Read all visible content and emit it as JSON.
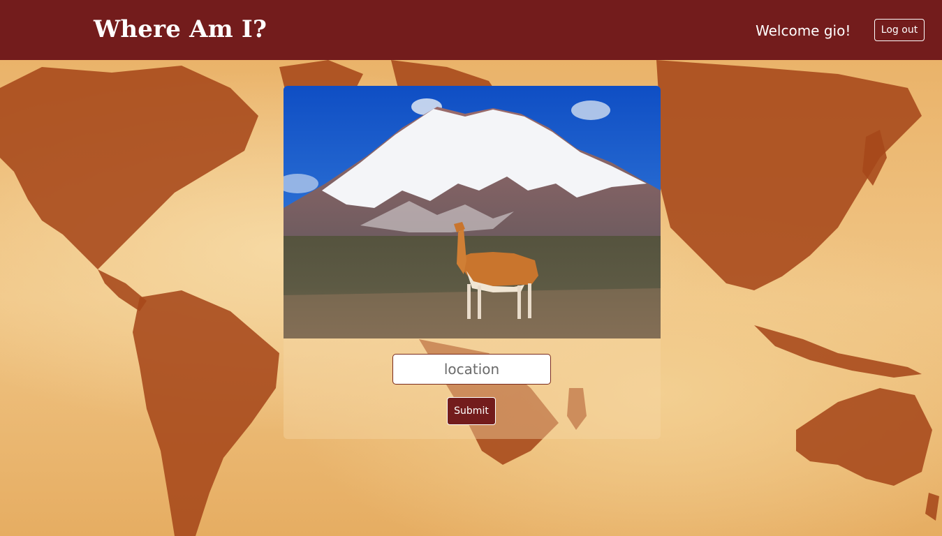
{
  "header": {
    "title": "Where Am I?",
    "welcome": "Welcome gio!",
    "logout_label": "Log out",
    "background_color": "#731c1c"
  },
  "game": {
    "photo_alt": "",
    "location_placeholder": "location",
    "location_value": "",
    "submit_label": "Submit"
  },
  "colors": {
    "brand": "#731c1c",
    "map_land": "#a6481a",
    "map_sea": "#f0c585"
  }
}
